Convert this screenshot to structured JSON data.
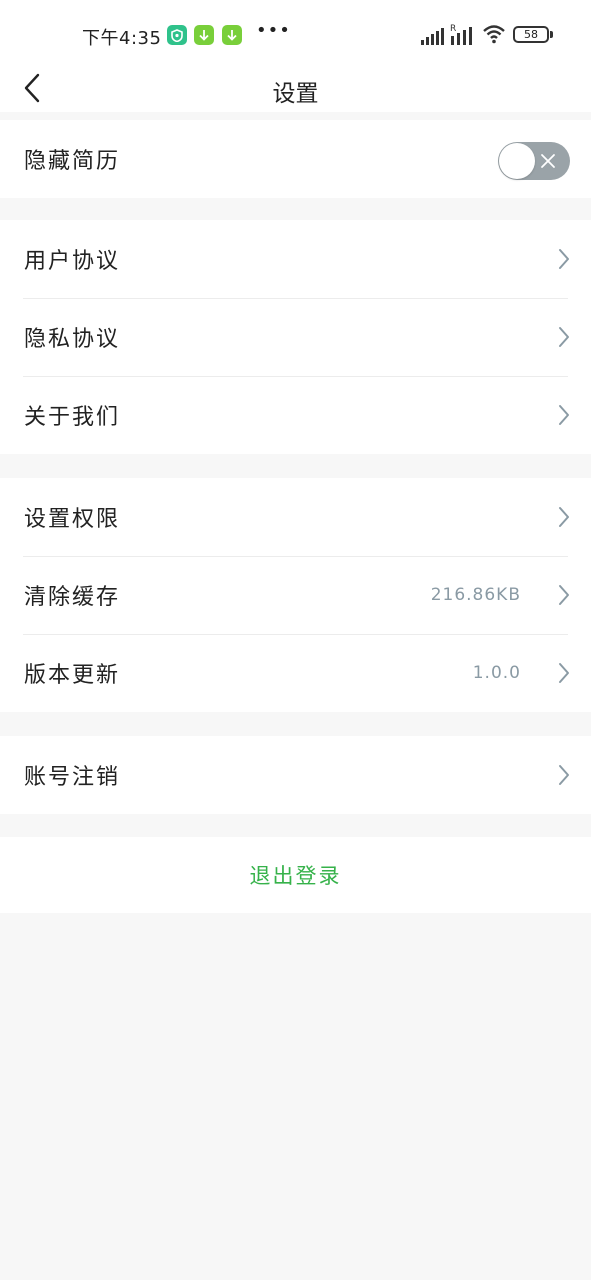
{
  "status_bar": {
    "time": "下午4:35",
    "apps": [
      {
        "icon": "shield-app-icon",
        "color": "#2fc28b"
      },
      {
        "icon": "download-app-icon",
        "color": "#79cf3a"
      },
      {
        "icon": "download-app-icon",
        "color": "#79cf3a"
      }
    ],
    "more": "•••",
    "battery": "58"
  },
  "header": {
    "title": "设置",
    "back_icon": "chevron-left-icon"
  },
  "sections": {
    "privacy": {
      "hide_resume_label": "隐藏简历",
      "hide_resume_enabled": false
    },
    "agreements": [
      {
        "label": "用户协议"
      },
      {
        "label": "隐私协议"
      },
      {
        "label": "关于我们"
      }
    ],
    "system": {
      "permissions_label": "设置权限",
      "clear_cache_label": "清除缓存",
      "cache_size": "216.86KB",
      "version_label": "版本更新",
      "version_value": "1.0.0"
    },
    "account": {
      "cancel_label": "账号注销"
    }
  },
  "logout": {
    "label": "退出登录",
    "color": "#36b24a"
  },
  "colors": {
    "background": "#f7f7f7",
    "secondary_text": "#8a9aa4",
    "accent": "#36b24a",
    "toggle_off": "#9aa3a8"
  }
}
